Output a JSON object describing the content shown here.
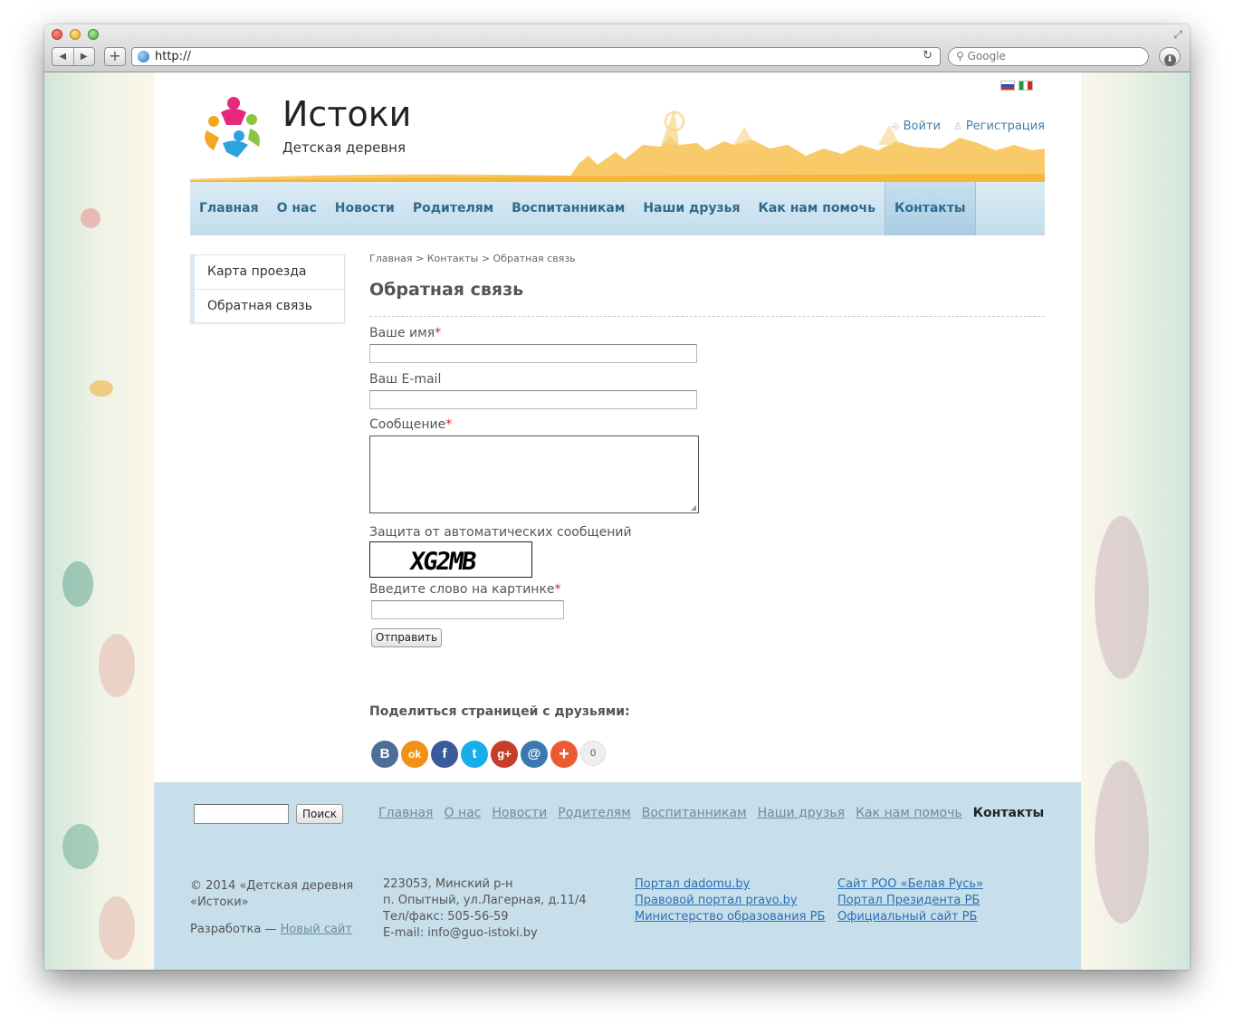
{
  "browser": {
    "url": "http://",
    "search_placeholder": "Google"
  },
  "site": {
    "title": "Истоки",
    "subtitle": "Детская деревня",
    "login": "Войти",
    "register": "Регистрация"
  },
  "nav": [
    {
      "label": "Главная"
    },
    {
      "label": "О нас"
    },
    {
      "label": "Новости"
    },
    {
      "label": "Родителям"
    },
    {
      "label": "Воспитанникам"
    },
    {
      "label": "Наши друзья"
    },
    {
      "label": "Как нам помочь"
    },
    {
      "label": "Контакты",
      "active": true
    }
  ],
  "sidebar": {
    "items": [
      {
        "label": "Карта проезда"
      },
      {
        "label": "Обратная связь"
      }
    ]
  },
  "breadcrumb": "Главная > Контакты > Обратная связь",
  "page_title": "Обратная связь",
  "form": {
    "name_label": "Ваше имя",
    "email_label": "Ваш E-mail",
    "message_label": "Сообщение",
    "required_mark": "*",
    "captcha_label": "Защита от автоматических сообщений",
    "captcha_text": "XG2MB",
    "captcha_input_label": "Введите слово на картинке",
    "submit_label": "Отправить"
  },
  "share": {
    "title": "Поделиться страницей с друзьями:",
    "buttons": [
      {
        "name": "vk",
        "glyph": "B",
        "color": "#4d6e96"
      },
      {
        "name": "odnoklassniki",
        "glyph": "ok",
        "color": "#f39018"
      },
      {
        "name": "facebook",
        "glyph": "f",
        "color": "#3b5a9a"
      },
      {
        "name": "twitter",
        "glyph": "t",
        "color": "#18aeeb"
      },
      {
        "name": "google-plus",
        "glyph": "g+",
        "color": "#c43e2b"
      },
      {
        "name": "mail",
        "glyph": "@",
        "color": "#3c78b0"
      },
      {
        "name": "more",
        "glyph": "+",
        "color": "#eb5a32"
      }
    ],
    "count": "0"
  },
  "footer": {
    "search_button": "Поиск",
    "copyright_line1": "© 2014 «Детская деревня",
    "copyright_line2": "«Истоки»",
    "dev_prefix": "Разработка — ",
    "dev_link": "Новый сайт",
    "address_line1": "223053, Минский р-н",
    "address_line2": "п. Опытный, ул.Лагерная, д.11/4",
    "phone": "Тел/факс: 505-56-59",
    "email": "E-mail: info@guo-istoki.by",
    "links_col1": [
      "Портал dadomu.by",
      "Правовой портал pravo.by",
      "Министерство образования РБ"
    ],
    "links_col2": [
      "Сайт РОО «Белая Русь»",
      "Портал Президента РБ",
      "Официальный сайт РБ"
    ]
  }
}
